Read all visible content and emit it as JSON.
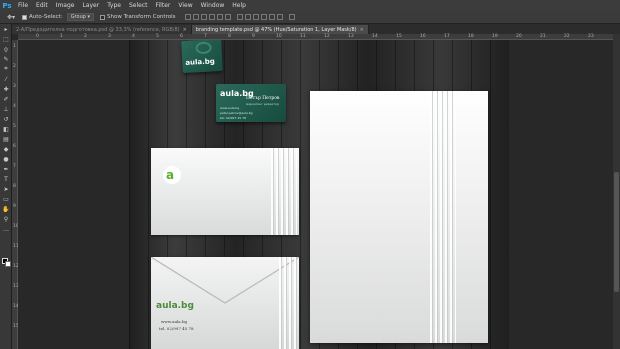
{
  "app": {
    "logo": "Ps"
  },
  "menu": [
    "File",
    "Edit",
    "Image",
    "Layer",
    "Type",
    "Select",
    "Filter",
    "View",
    "Window",
    "Help"
  ],
  "options": {
    "tool_icon": "move-tool-icon",
    "auto_select_label": "Auto-Select:",
    "auto_select_checked": true,
    "auto_select_value": "Group",
    "show_transform_label": "Show Transform Controls",
    "show_transform_checked": false
  },
  "tabs": [
    {
      "label": "2-A/Предодителна подготовка.psd @ 33,3% (reference, RGB/8)",
      "close": "×",
      "active": false
    },
    {
      "label": "branding template.psd @ 47% (Hue/Saturation 1, Layer Mask/8)",
      "close": "×",
      "active": true
    }
  ],
  "ruler_h": [
    "0",
    "1",
    "2",
    "3",
    "4",
    "5",
    "6",
    "7",
    "8",
    "9",
    "10",
    "11",
    "12",
    "13",
    "14",
    "15",
    "16",
    "17",
    "18",
    "19",
    "20",
    "21",
    "22",
    "23",
    "24",
    "25"
  ],
  "ruler_v": [
    "1",
    "2",
    "3",
    "4",
    "5",
    "6",
    "7",
    "8",
    "9",
    "10",
    "11",
    "12",
    "13",
    "14",
    "15"
  ],
  "canvas": {
    "card1": {
      "logo": "aula.bg"
    },
    "card2": {
      "logo": "aula.bg",
      "name": "Петър Петров",
      "role": "маркетинг директор",
      "lines": [
        "www.aula.bg",
        "petar.petrov@aula.bg",
        "tel: 02/997 45 78"
      ]
    },
    "envelope_front": {
      "logo_letter": "a"
    },
    "envelope_back": {
      "logo": "aula.bg",
      "web": "www.aula.bg",
      "tel": "tel. 02/997 45 78"
    }
  },
  "colors": {
    "brand_green": "#5cae2e",
    "card_teal": "#1f5a4c",
    "ps_blue": "#31a8ff"
  }
}
